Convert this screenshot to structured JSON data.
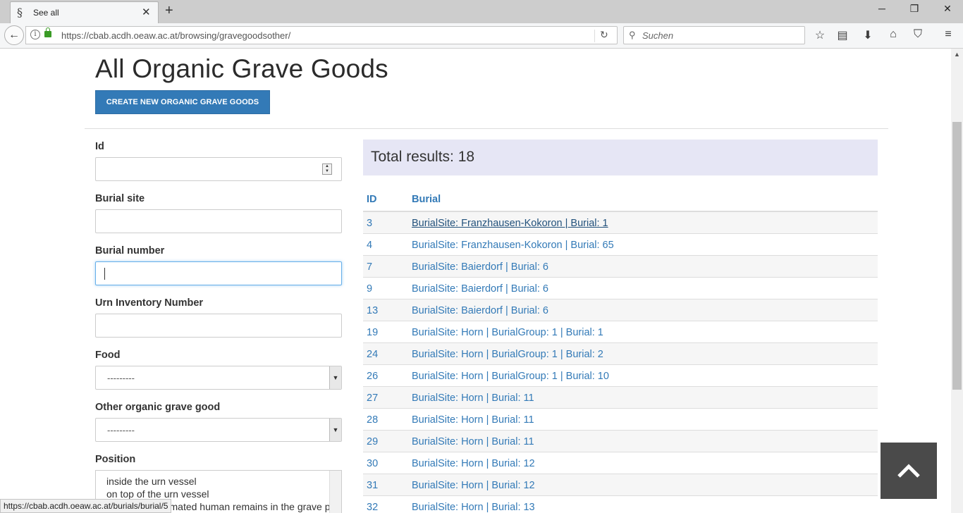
{
  "browser": {
    "tab_title": "See all",
    "tab_favicon": "§",
    "url": "https://cbab.acdh.oeaw.ac.at/browsing/gravegoodsother/",
    "search_placeholder": "Suchen",
    "status_url": "https://cbab.acdh.oeaw.ac.at/burials/burial/5",
    "icons": [
      "back-icon",
      "info-icon",
      "lock-icon",
      "reload-icon",
      "search-icon",
      "star-icon",
      "reading-list-icon",
      "download-icon",
      "home-icon",
      "pocket-icon",
      "menu-icon"
    ]
  },
  "page": {
    "title": "All Organic Grave Goods",
    "create_button": "CREATE NEW ORGANIC GRAVE GOODS"
  },
  "filters": {
    "id_label": "Id",
    "burial_site_label": "Burial site",
    "burial_number_label": "Burial number",
    "urn_inventory_label": "Urn Inventory Number",
    "food_label": "Food",
    "food_value": "---------",
    "other_label": "Other organic grave good",
    "other_value": "---------",
    "position_label": "Position",
    "position_options": [
      "inside the urn vessel",
      "on top of the urn vessel",
      "among the cremated human remains in the grave pit"
    ]
  },
  "results": {
    "total_text": "Total results: 18",
    "columns": [
      "ID",
      "Burial"
    ],
    "rows": [
      {
        "id": "3",
        "burial": "BurialSite: Franzhausen-Kokoron | Burial: 1"
      },
      {
        "id": "4",
        "burial": "BurialSite: Franzhausen-Kokoron | Burial: 65"
      },
      {
        "id": "7",
        "burial": "BurialSite: Baierdorf | Burial: 6"
      },
      {
        "id": "9",
        "burial": "BurialSite: Baierdorf | Burial: 6"
      },
      {
        "id": "13",
        "burial": "BurialSite: Baierdorf | Burial: 6"
      },
      {
        "id": "19",
        "burial": "BurialSite: Horn | BurialGroup: 1 | Burial: 1"
      },
      {
        "id": "24",
        "burial": "BurialSite: Horn | BurialGroup: 1 | Burial: 2"
      },
      {
        "id": "26",
        "burial": "BurialSite: Horn | BurialGroup: 1 | Burial: 10"
      },
      {
        "id": "27",
        "burial": "BurialSite: Horn | Burial: 11"
      },
      {
        "id": "28",
        "burial": "BurialSite: Horn | Burial: 11"
      },
      {
        "id": "29",
        "burial": "BurialSite: Horn | Burial: 11"
      },
      {
        "id": "30",
        "burial": "BurialSite: Horn | Burial: 12"
      },
      {
        "id": "31",
        "burial": "BurialSite: Horn | Burial: 12"
      },
      {
        "id": "32",
        "burial": "BurialSite: Horn | Burial: 13"
      }
    ]
  },
  "colors": {
    "link": "#337ab7",
    "button": "#337ab7",
    "results_bg": "#e6e6f5",
    "back_to_top": "#4a4a4a"
  }
}
